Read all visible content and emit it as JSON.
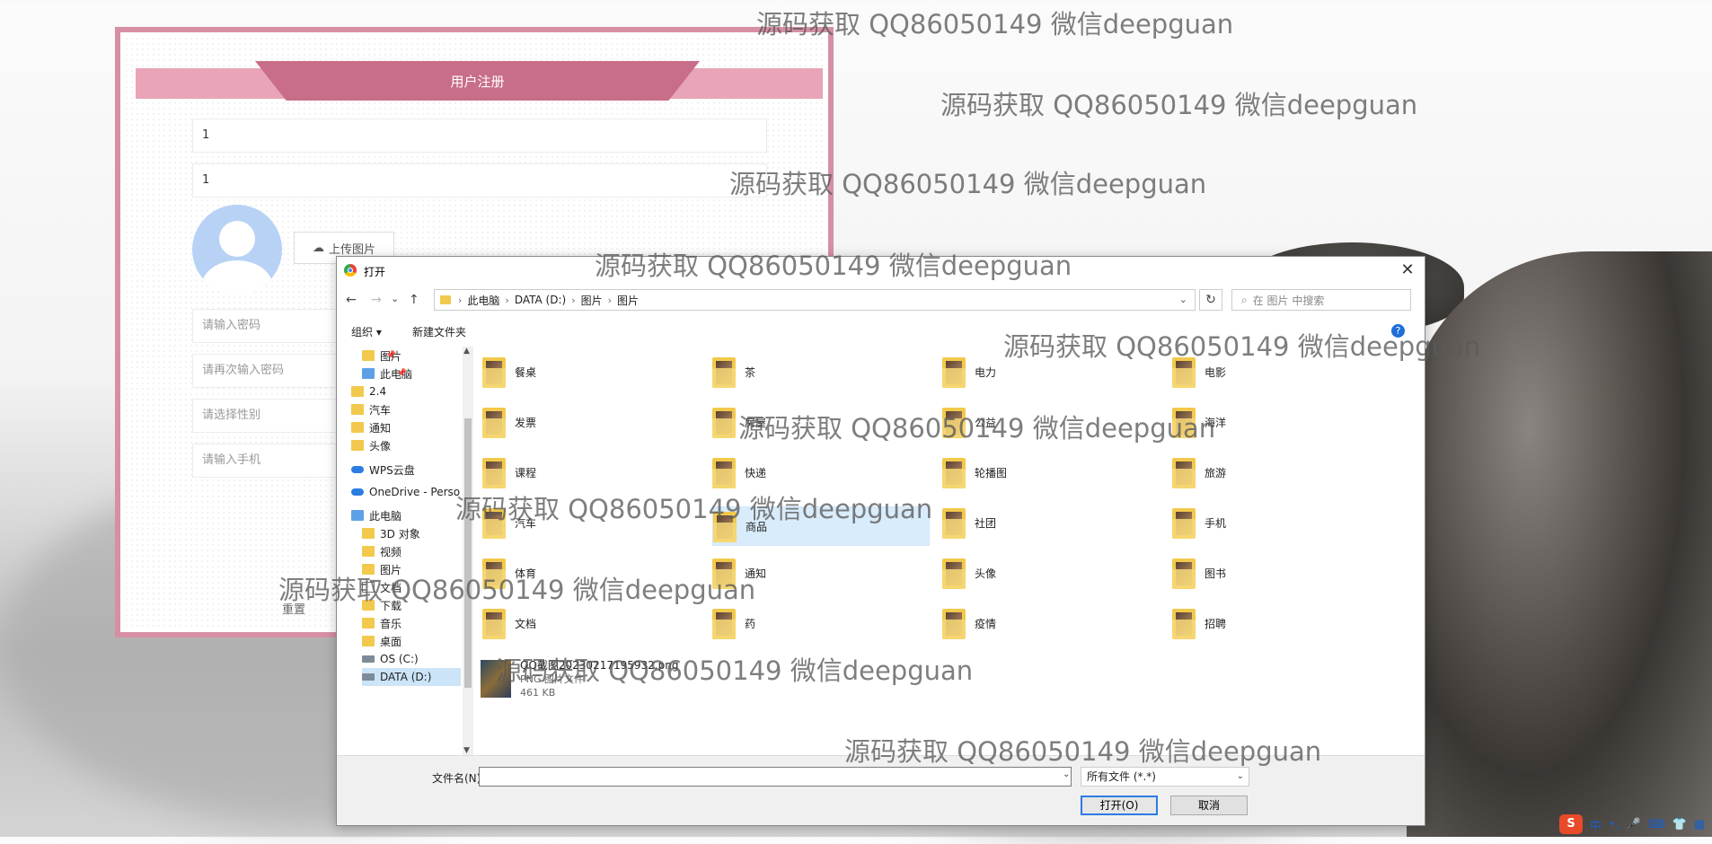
{
  "registration": {
    "title": "用户注册",
    "field1_value": "1",
    "field2_value": "1",
    "upload_label": "上传图片",
    "password_placeholder": "请输入密码",
    "password_confirm_placeholder": "请再次输入密码",
    "gender_placeholder": "请选择性别",
    "phone_placeholder": "请输入手机",
    "reset_label": "重置"
  },
  "dialog": {
    "title": "打开",
    "close_glyph": "✕",
    "nav": {
      "back": "←",
      "forward": "→",
      "recent": "⌄",
      "up": "↑"
    },
    "breadcrumb": [
      "此电脑",
      "DATA (D:)",
      "图片",
      "图片"
    ],
    "breadcrumb_sep": "›",
    "refresh_glyph": "↻",
    "search_placeholder": "在 图片 中搜索",
    "toolbar": {
      "organize": "组织 ▾",
      "new_folder": "新建文件夹",
      "help": "?"
    },
    "sidebar": [
      {
        "label": "图片",
        "icon": "folder-icon",
        "pinned": true
      },
      {
        "label": "此电脑",
        "icon": "pc-icon",
        "pinned": true
      },
      {
        "label": "2.4",
        "icon": "folder-icon"
      },
      {
        "label": "汽车",
        "icon": "folder-icon"
      },
      {
        "label": "通知",
        "icon": "folder-icon"
      },
      {
        "label": "头像",
        "icon": "folder-icon"
      },
      {
        "label": "WPS云盘",
        "icon": "cloud-icon"
      },
      {
        "label": "OneDrive - Perso",
        "icon": "cloud-icon"
      },
      {
        "label": "此电脑",
        "icon": "pc-icon"
      },
      {
        "label": "3D 对象",
        "icon": "cube-icon"
      },
      {
        "label": "视频",
        "icon": "video-icon"
      },
      {
        "label": "图片",
        "icon": "picture-icon"
      },
      {
        "label": "文档",
        "icon": "document-icon"
      },
      {
        "label": "下载",
        "icon": "download-icon"
      },
      {
        "label": "音乐",
        "icon": "music-icon"
      },
      {
        "label": "桌面",
        "icon": "desktop-icon"
      },
      {
        "label": "OS (C:)",
        "icon": "drive-icon"
      },
      {
        "label": "DATA (D:)",
        "icon": "drive-icon"
      }
    ],
    "folders": [
      "餐桌",
      "茶",
      "电力",
      "电影",
      "发票",
      "房屋",
      "公益",
      "海洋",
      "课程",
      "快递",
      "轮播图",
      "旅游",
      "汽车",
      "商品",
      "社团",
      "手机",
      "体育",
      "通知",
      "头像",
      "图书",
      "文档",
      "药",
      "疫情",
      "招聘"
    ],
    "selected_folder": "商品",
    "file": {
      "name": "QQ截图20230217195932.png",
      "type": "PNG 图片文件",
      "size": "461 KB"
    },
    "filename_label": "文件名(N):",
    "filename_value": "",
    "filetype_value": "所有文件 (*.*)",
    "open_button": "打开(O)",
    "cancel_button": "取消"
  },
  "watermark_text": "源码获取 QQ86050149 微信deepguan",
  "tray": {
    "ime": "S",
    "lang": "中",
    "items": [
      "•,",
      "🎤",
      "⌨",
      "👕",
      "▦"
    ]
  }
}
